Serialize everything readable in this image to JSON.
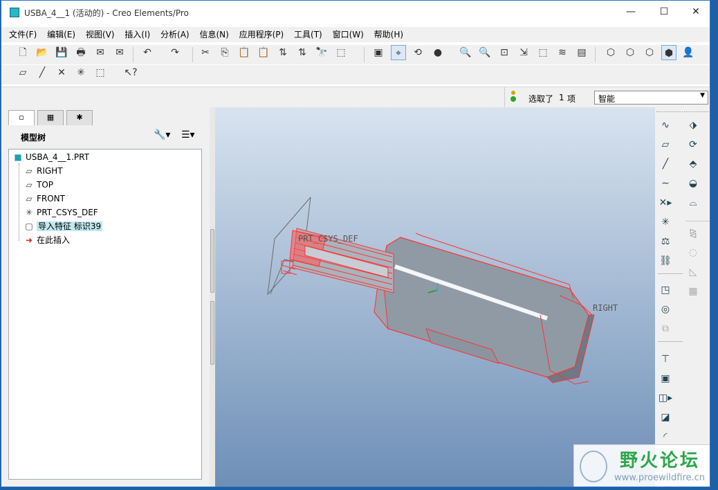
{
  "window": {
    "title": "USBA_4__1 (活动的) - Creo Elements/Pro",
    "minimize": "—",
    "maximize": "☐",
    "close": "✕"
  },
  "menu": [
    "文件(F)",
    "编辑(E)",
    "视图(V)",
    "插入(I)",
    "分析(A)",
    "信息(N)",
    "应用程序(P)",
    "工具(T)",
    "窗口(W)",
    "帮助(H)"
  ],
  "status": {
    "selected_label": "选取了",
    "selected_count": "1",
    "selected_unit": "项",
    "filter_value": "智能"
  },
  "model_tree": {
    "title": "模型树",
    "root": "USBA_4__1.PRT",
    "items": [
      {
        "label": "RIGHT",
        "icon": "datum-plane-icon"
      },
      {
        "label": "TOP",
        "icon": "datum-plane-icon"
      },
      {
        "label": "FRONT",
        "icon": "datum-plane-icon"
      },
      {
        "label": "PRT_CSYS_DEF",
        "icon": "csys-icon"
      },
      {
        "label": "导入特征 标识39",
        "icon": "import-feature-icon",
        "highlighted": true
      },
      {
        "label": "在此插入",
        "icon": "insert-here-arrow-icon"
      }
    ]
  },
  "viewport": {
    "label_csys": "PRT_CSYS_DEF",
    "label_right": "RIGHT",
    "wire_color": "#ff3333",
    "background_top": "#d8e3ef",
    "background_bottom": "#6e8fb7"
  },
  "watermark": {
    "text": "野火论坛",
    "url": "www.proewildfire.cn"
  }
}
